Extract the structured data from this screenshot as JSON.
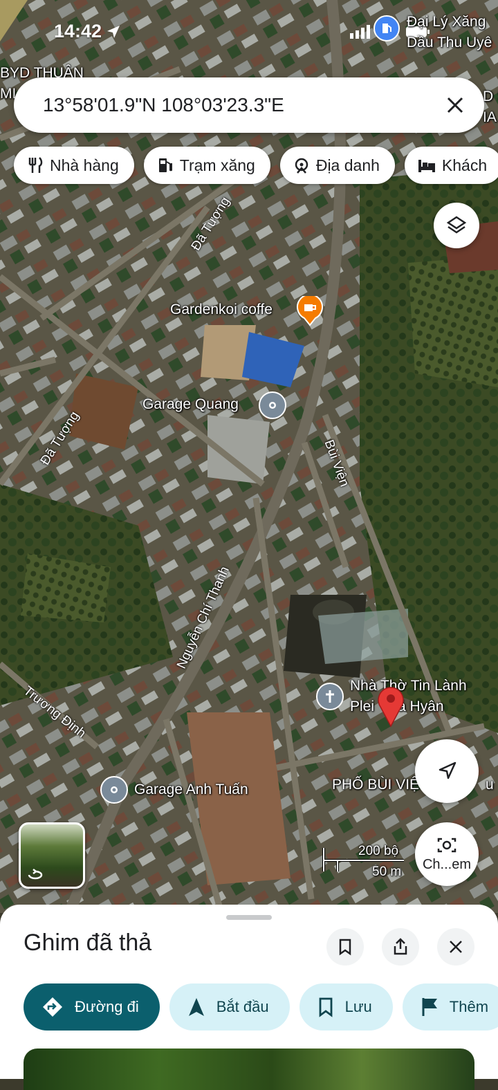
{
  "status": {
    "time": "14:42"
  },
  "search": {
    "coordinates": "13°58'01.9\"N 108°03'23.3\"E"
  },
  "chips": [
    {
      "label": "Nhà hàng",
      "icon": "fork-knife-icon"
    },
    {
      "label": "Trạm xăng",
      "icon": "gas-pump-icon"
    },
    {
      "label": "Địa danh",
      "icon": "landmark-icon"
    },
    {
      "label": "Khách",
      "icon": "bed-icon"
    }
  ],
  "map": {
    "corner_labels": [
      "Đại Lý Xăng",
      "Dầu Thu Uyê",
      "BYD THUẬN",
      "MI",
      "D S",
      "IA"
    ],
    "pois": [
      {
        "name": "Gardenkoi coffe",
        "icon": "coffee-icon",
        "color": "#f57c00"
      },
      {
        "name": "Garage Quang",
        "icon": "pin-icon",
        "color": "#7a8a99"
      },
      {
        "name": "Garage Anh Tuấn",
        "icon": "pin-icon",
        "color": "#7a8a99"
      },
      {
        "name_line1": "Nhà Thờ Tin Lành",
        "name_line2": "Plei",
        "name_line2b": "á Hyân",
        "icon": "church-cross-icon",
        "color": "#7a8a99"
      }
    ],
    "streets": [
      "Đã Tượng",
      "Đã Tượng",
      "Bùi Viện",
      "Nguyễn Chí Thanh",
      "Trương Định"
    ],
    "area_label": "PHỐ BÙI VIỆ",
    "area_label_tail": "u",
    "scale": {
      "feet": "200 bộ",
      "meters": "50 m"
    },
    "camera_label": "Ch...em",
    "pin_color": "#e53935"
  },
  "sheet": {
    "title": "Ghim đã thả",
    "actions": [
      {
        "label": "Đường đi",
        "icon": "directions-icon"
      },
      {
        "label": "Bắt đầu",
        "icon": "navigation-arrow-icon"
      },
      {
        "label": "Lưu",
        "icon": "bookmark-icon"
      },
      {
        "label": "Thêm",
        "icon": "flag-icon"
      }
    ]
  }
}
